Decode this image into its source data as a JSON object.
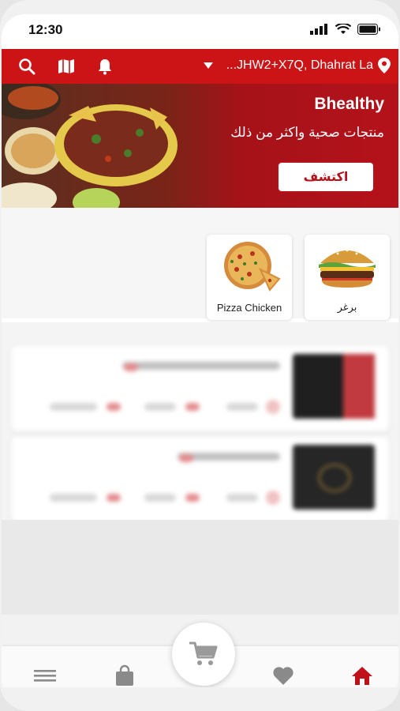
{
  "status_bar": {
    "time": "12:30"
  },
  "header": {
    "location": "...JHW2+X7Q, Dhahrat La",
    "icons": [
      "search-icon",
      "map-icon",
      "bell-icon",
      "chevron-down-icon",
      "location-pin-icon"
    ]
  },
  "banner": {
    "title": "Bhealthy",
    "subtitle": "منتجات صحية واكثر من ذلك",
    "cta": "اكتشف"
  },
  "categories": [
    {
      "label": "برغر",
      "icon": "burger-icon"
    },
    {
      "label": "Pizza Chicken",
      "icon": "pizza-icon"
    }
  ],
  "bottom_nav": {
    "items": [
      "menu-icon",
      "bag-icon",
      "cart-icon",
      "heart-icon",
      "home-icon"
    ],
    "active": "home-icon"
  },
  "colors": {
    "brand": "#cc1417",
    "active_icon": "#c0101a",
    "inactive_icon": "#8a8a8a"
  }
}
